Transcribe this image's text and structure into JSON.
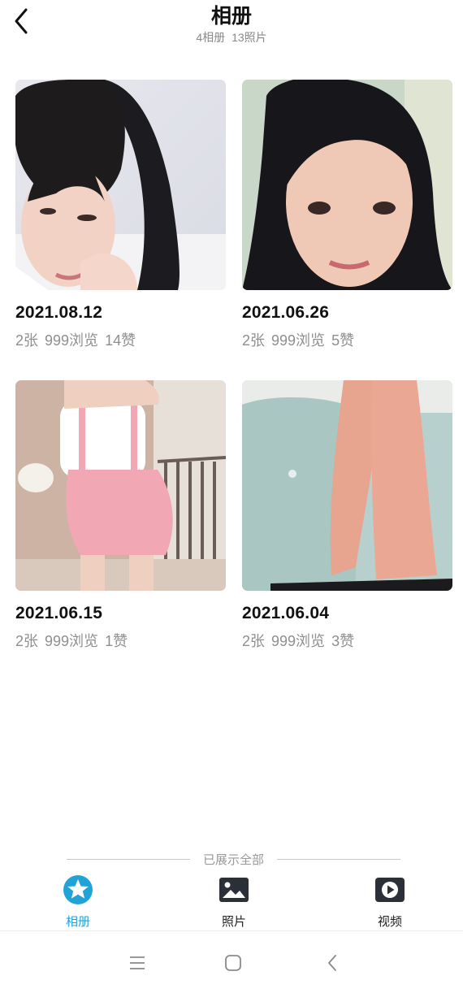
{
  "header": {
    "title": "相册",
    "album_count": "4相册",
    "photo_count": "13照片"
  },
  "albums": [
    {
      "date": "2021.08.12",
      "photos": "2张",
      "views": "999浏览",
      "likes": "14赞"
    },
    {
      "date": "2021.06.26",
      "photos": "2张",
      "views": "999浏览",
      "likes": "5赞"
    },
    {
      "date": "2021.06.15",
      "photos": "2张",
      "views": "999浏览",
      "likes": "1赞"
    },
    {
      "date": "2021.06.04",
      "photos": "2张",
      "views": "999浏览",
      "likes": "3赞"
    }
  ],
  "end_note": "已展示全部",
  "tabs": [
    {
      "label": "相册",
      "icon": "album-star-icon",
      "active": true
    },
    {
      "label": "照片",
      "icon": "photo-icon",
      "active": false
    },
    {
      "label": "视频",
      "icon": "video-play-icon",
      "active": false
    }
  ],
  "colors": {
    "accent": "#22a3d8",
    "muted_text": "#8f8f8f"
  },
  "system_nav": [
    "menu-icon",
    "home-square-icon",
    "back-chevron-icon"
  ]
}
